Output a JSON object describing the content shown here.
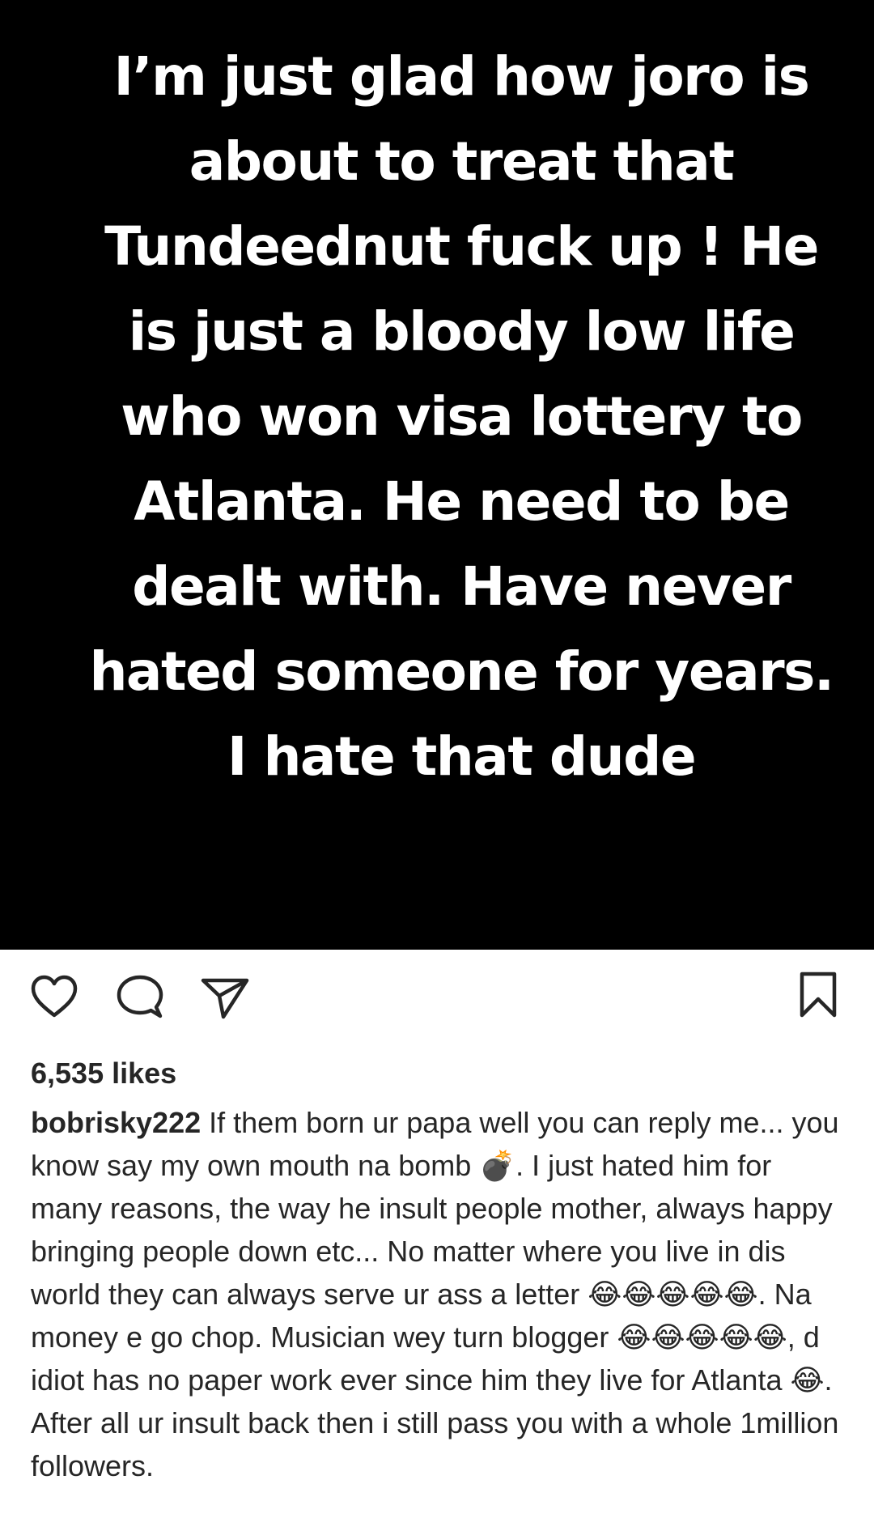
{
  "post": {
    "image_text": "I’m just glad how joro is about to treat that Tundeednut fuck up ! He is just a bloody low life who won visa lottery to Atlanta. He need to be dealt with. Have never hated someone for years. I hate that dude",
    "background_color": "#000000",
    "text_color": "#ffffff"
  },
  "actions": {
    "like_icon": "heart-icon",
    "comment_icon": "comment-icon",
    "share_icon": "paper-plane-icon",
    "save_icon": "bookmark-icon"
  },
  "likes_text": "6,535 likes",
  "caption": {
    "username": "bobrisky222",
    "text": "If them born ur papa well you can reply me... you know say my own mouth na bomb 💣. I just hated him for many reasons, the way he insult people mother, always happy bringing people down etc... No matter where you live in dis world they can always serve ur ass a letter 😂😂😂😂😂. Na money e go chop. Musician wey turn blogger 😂😂😂😂😂, d idiot has no paper work ever since him they live for Atlanta 😂. After all ur insult back then i still pass you with a whole 1million followers."
  }
}
